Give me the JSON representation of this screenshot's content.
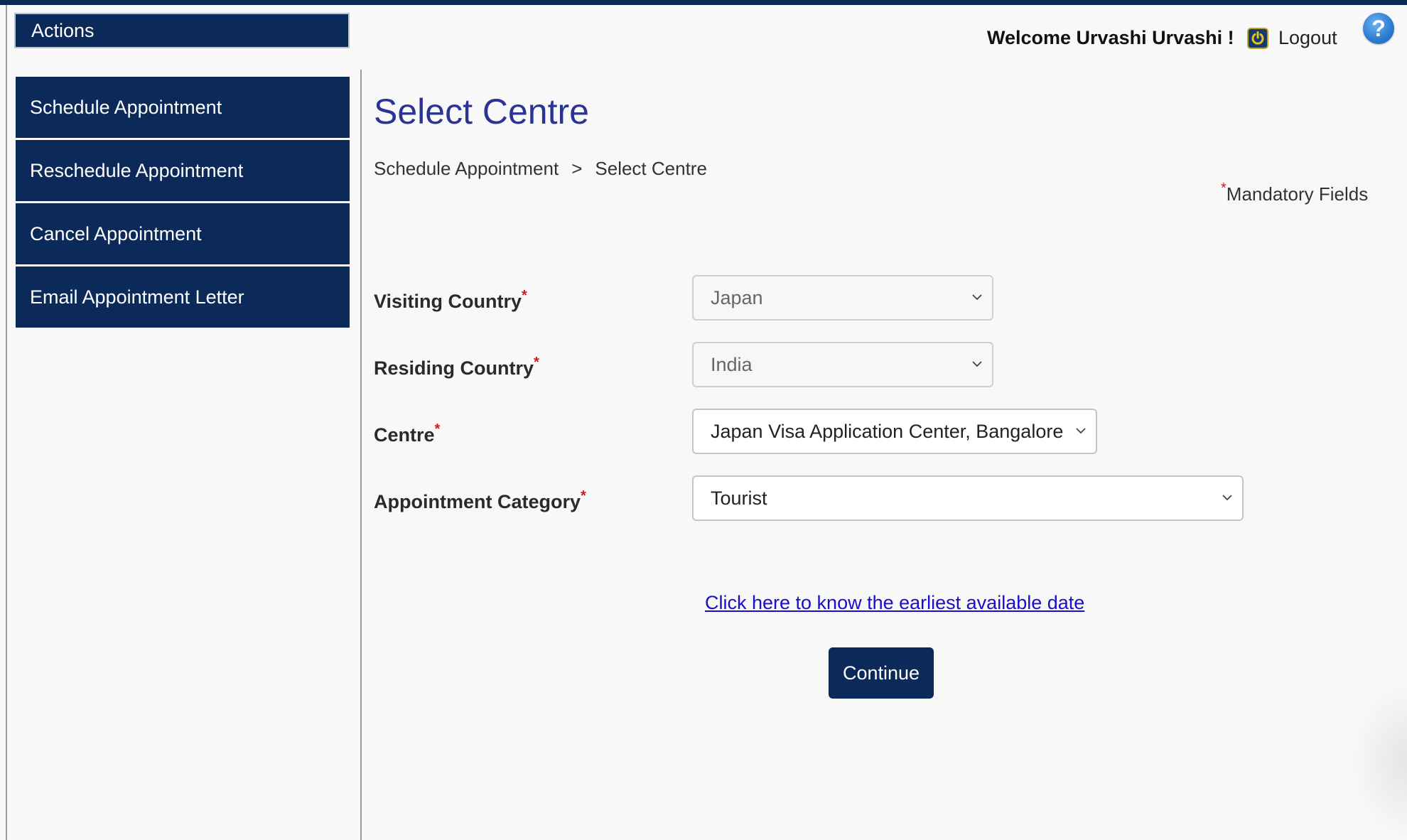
{
  "sidebar": {
    "header": "Actions",
    "items": [
      {
        "label": "Schedule Appointment"
      },
      {
        "label": "Reschedule Appointment"
      },
      {
        "label": "Cancel Appointment"
      },
      {
        "label": "Email Appointment Letter"
      }
    ]
  },
  "header": {
    "welcome": "Welcome Urvashi Urvashi !",
    "logout_label": "Logout",
    "help_label": "?"
  },
  "main": {
    "title": "Select Centre",
    "breadcrumb": {
      "items": [
        "Schedule Appointment",
        "Select Centre"
      ],
      "separator": ">"
    },
    "mandatory_star": "*",
    "mandatory_text": "Mandatory Fields",
    "form": {
      "fields": [
        {
          "label": "Visiting Country",
          "required_mark": "*",
          "value": "Japan"
        },
        {
          "label": "Residing Country",
          "required_mark": "*",
          "value": "India"
        },
        {
          "label": "Centre",
          "required_mark": "*",
          "value": "Japan Visa Application Center, Bangalore"
        },
        {
          "label": "Appointment Category",
          "required_mark": "*",
          "value": "Tourist"
        }
      ]
    },
    "earliest_link": "Click here to know the earliest available date",
    "continue_label": "Continue"
  },
  "colors": {
    "navy": "#0b2a5a",
    "title_blue": "#2b3494",
    "required_red": "#d11a1a",
    "link_blue": "#1a0dcc"
  },
  "icons": {
    "logout": "power-icon",
    "help": "help-icon",
    "dropdown": "chevron-down-icon"
  }
}
